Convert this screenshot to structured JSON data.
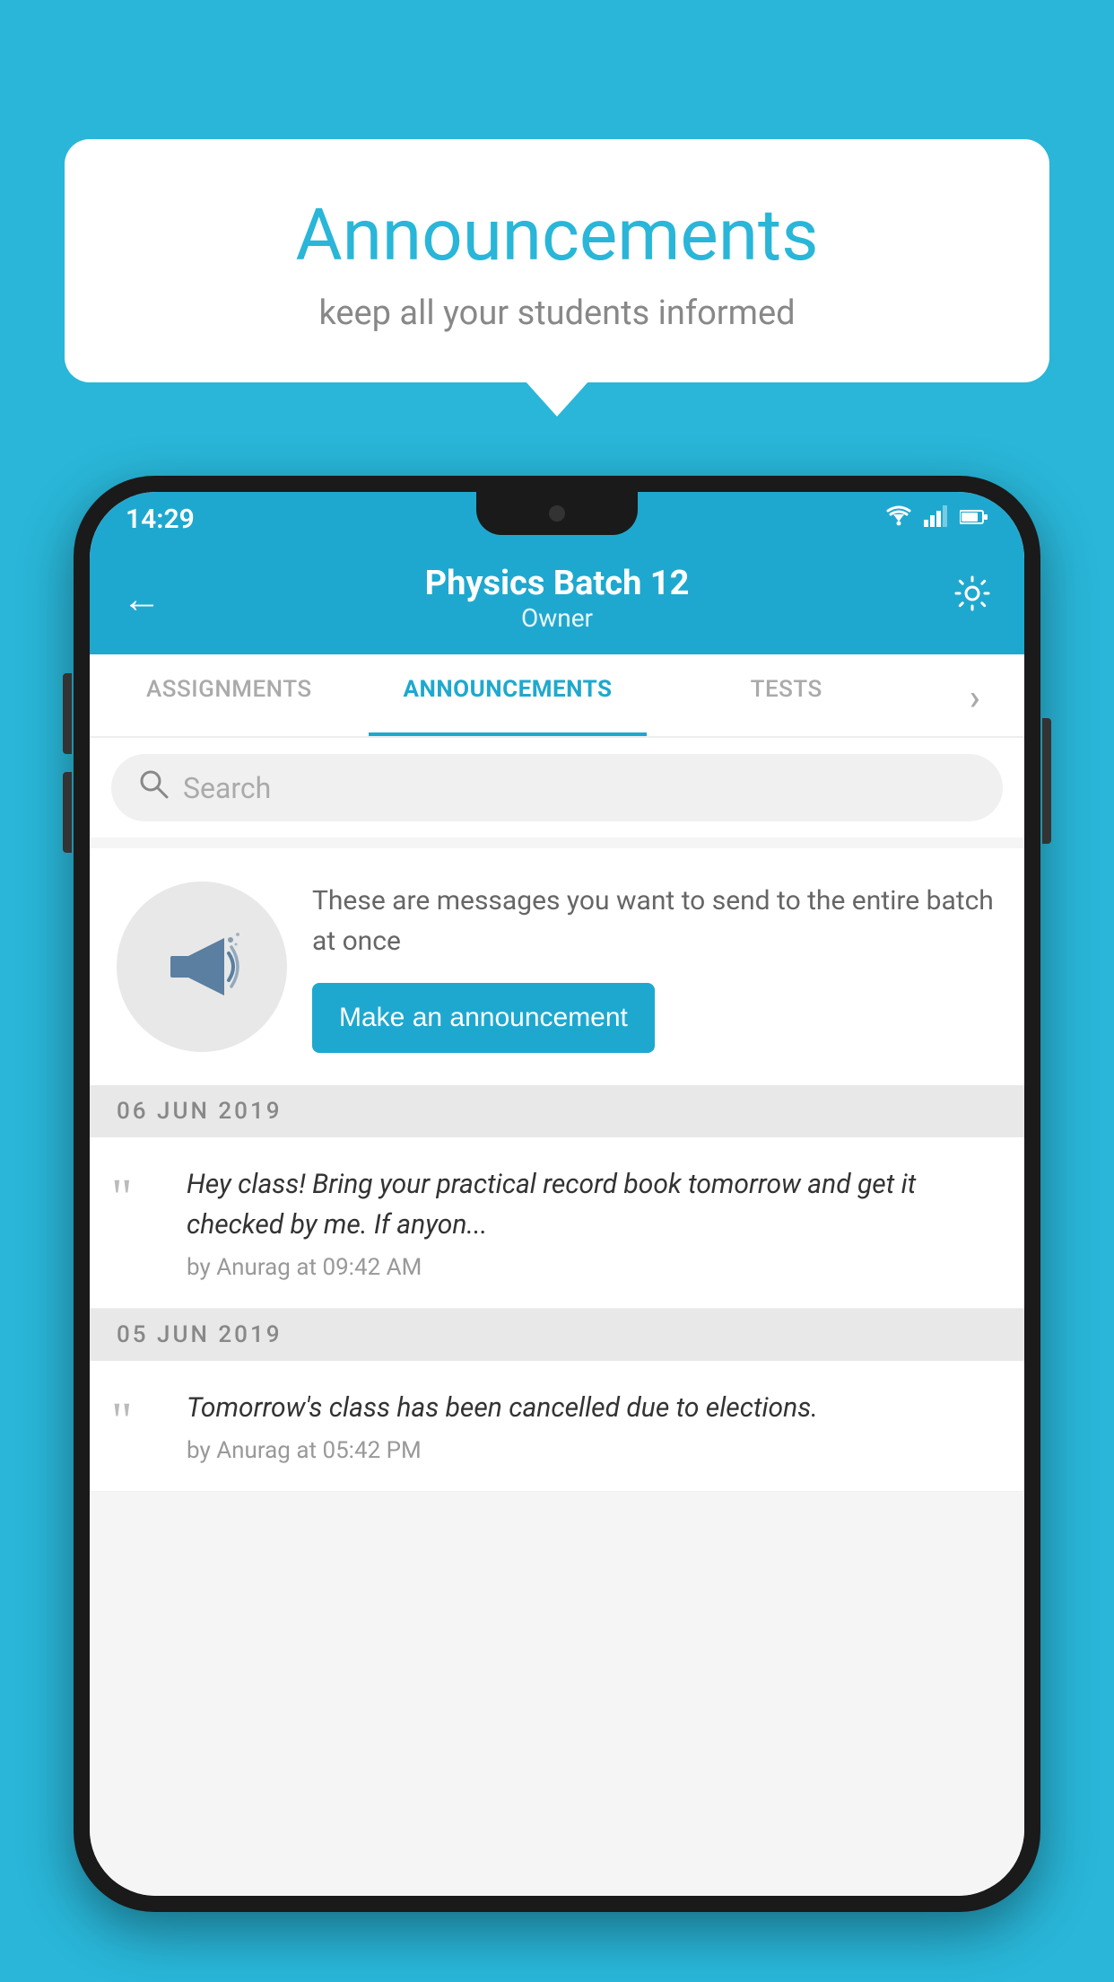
{
  "background_color": "#29b6d8",
  "speech_bubble": {
    "title": "Announcements",
    "subtitle": "keep all your students informed"
  },
  "phone": {
    "status_bar": {
      "time": "14:29",
      "wifi": "▼▲",
      "signal": "▲",
      "battery": "▮"
    },
    "header": {
      "back_label": "←",
      "title": "Physics Batch 12",
      "subtitle": "Owner",
      "gear_label": "⚙"
    },
    "tabs": [
      {
        "label": "ASSIGNMENTS",
        "active": false
      },
      {
        "label": "ANNOUNCEMENTS",
        "active": true
      },
      {
        "label": "TESTS",
        "active": false
      },
      {
        "label": "·",
        "active": false
      }
    ],
    "search": {
      "placeholder": "Search"
    },
    "promo": {
      "description": "These are messages you want to send to the entire batch at once",
      "button_label": "Make an announcement"
    },
    "announcements": [
      {
        "date": "06  JUN  2019",
        "text": "Hey class! Bring your practical record book tomorrow and get it checked by me. If anyon...",
        "meta": "by Anurag at 09:42 AM"
      },
      {
        "date": "05  JUN  2019",
        "text": "Tomorrow's class has been cancelled due to elections.",
        "meta": "by Anurag at 05:42 PM"
      }
    ]
  }
}
